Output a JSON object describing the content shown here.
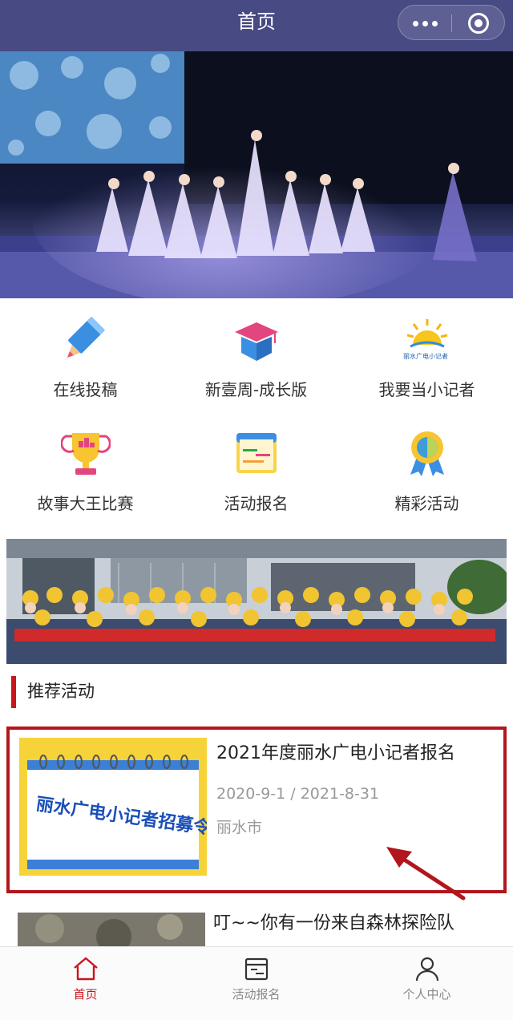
{
  "header": {
    "title": "首页"
  },
  "grid": [
    {
      "label": "在线投稿",
      "icon": "pencil-icon"
    },
    {
      "label": "新壹周-成长版",
      "icon": "graduation-cap-icon"
    },
    {
      "label": "我要当小记者",
      "icon": "sun-logo-icon",
      "logo_text": "丽水广电小记者"
    },
    {
      "label": "故事大王比赛",
      "icon": "trophy-icon"
    },
    {
      "label": "活动报名",
      "icon": "calendar-icon"
    },
    {
      "label": "精彩活动",
      "icon": "medal-icon"
    }
  ],
  "section": {
    "title": "推荐活动"
  },
  "activities": [
    {
      "title": "2021年度丽水广电小记者报名",
      "date_range": "2020-9-1 / 2021-8-31",
      "location": "丽水市",
      "poster_text": "丽水广电小记者招募令"
    },
    {
      "title": "叮~~你有一份来自森林探险队"
    }
  ],
  "tabbar": [
    {
      "label": "首页",
      "icon": "home-icon",
      "active": true
    },
    {
      "label": "活动报名",
      "icon": "calendar-icon",
      "active": false
    },
    {
      "label": "个人中心",
      "icon": "user-icon",
      "active": false
    }
  ],
  "colors": {
    "header_bg": "#484a84",
    "accent": "#c8161d",
    "card_border": "#b2161d"
  }
}
